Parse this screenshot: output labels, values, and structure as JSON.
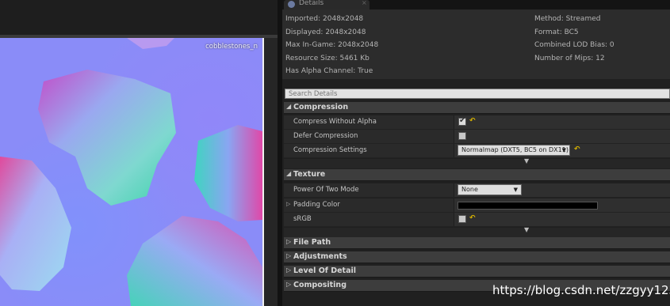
{
  "preview": {
    "texture_name": "cobblestones_n"
  },
  "tab": {
    "label": "Details",
    "close": "×"
  },
  "info": {
    "imported": "Imported: 2048x2048",
    "displayed": "Displayed: 2048x2048",
    "max_in_game": "Max In-Game: 2048x2048",
    "resource_size": "Resource Size: 5461 Kb",
    "has_alpha": "Has Alpha Channel: True",
    "method": "Method: Streamed",
    "format": "Format: BC5",
    "lod_bias": "Combined LOD Bias: 0",
    "mips": "Number of Mips: 12"
  },
  "search": {
    "placeholder": "Search Details"
  },
  "compression": {
    "title": "Compression",
    "compress_without_alpha": {
      "label": "Compress Without Alpha",
      "checked": true
    },
    "defer_compression": {
      "label": "Defer Compression",
      "checked": false
    },
    "compression_settings": {
      "label": "Compression Settings",
      "value": "Normalmap (DXT5, BC5 on DX11)"
    }
  },
  "texture": {
    "title": "Texture",
    "power_of_two": {
      "label": "Power Of Two Mode",
      "value": "None"
    },
    "padding_color": {
      "label": "Padding Color",
      "color": "#000000"
    },
    "srgb": {
      "label": "sRGB",
      "checked": false
    }
  },
  "categories": {
    "file_path": "File Path",
    "adjustments": "Adjustments",
    "level_of_detail": "Level Of Detail",
    "compositing": "Compositing"
  },
  "icons": {
    "expanded": "◢",
    "collapsed": "▷",
    "row_expand": "▷",
    "check": "✔",
    "reset": "↶",
    "caret": "▼",
    "advanced": "▼"
  },
  "watermark": "https://blog.csdn.net/zzgyy123"
}
